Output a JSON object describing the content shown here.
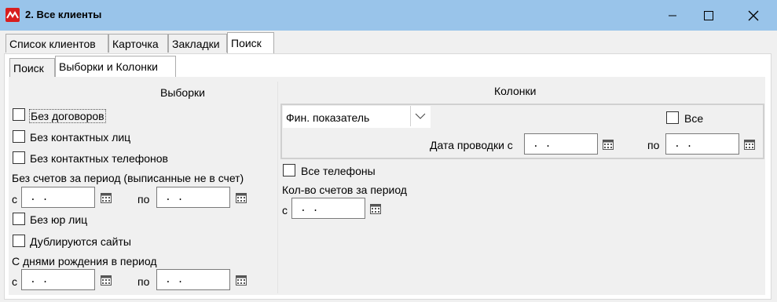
{
  "window": {
    "title": "2. Все клиенты",
    "accent_color": "#99c4ea",
    "icon": "app-logo-icon"
  },
  "main_tabs": [
    {
      "label": "Список клиентов"
    },
    {
      "label": "Карточка"
    },
    {
      "label": "Закладки"
    },
    {
      "label": "Поиск",
      "active": true
    }
  ],
  "sub_tabs": [
    {
      "label": "Поиск"
    },
    {
      "label": "Выборки и Колонки",
      "active": true
    }
  ],
  "selections": {
    "heading": "Выборки",
    "no_contracts": "Без договоров",
    "no_contacts": "Без контактных лиц",
    "no_contact_phones": "Без контактных телефонов",
    "no_invoices_label": "Без счетов за период (выписанные не в счет)",
    "from_label": "с",
    "to_label": "по",
    "date_empty": ". .",
    "no_legal_entities": "Без юр лиц",
    "duplicate_sites": "Дублируются сайты",
    "birthdays_label": "С днями рождения в период"
  },
  "columns": {
    "heading": "Колонки",
    "fin_indicator": "Фин. показатель",
    "all_label": "Все",
    "posting_date_label": "Дата проводки с",
    "to_label": "по",
    "date_empty": ". .",
    "all_phones": "Все телефоны",
    "invoices_count_label": "Кол-во счетов за период",
    "from_label": "с"
  }
}
